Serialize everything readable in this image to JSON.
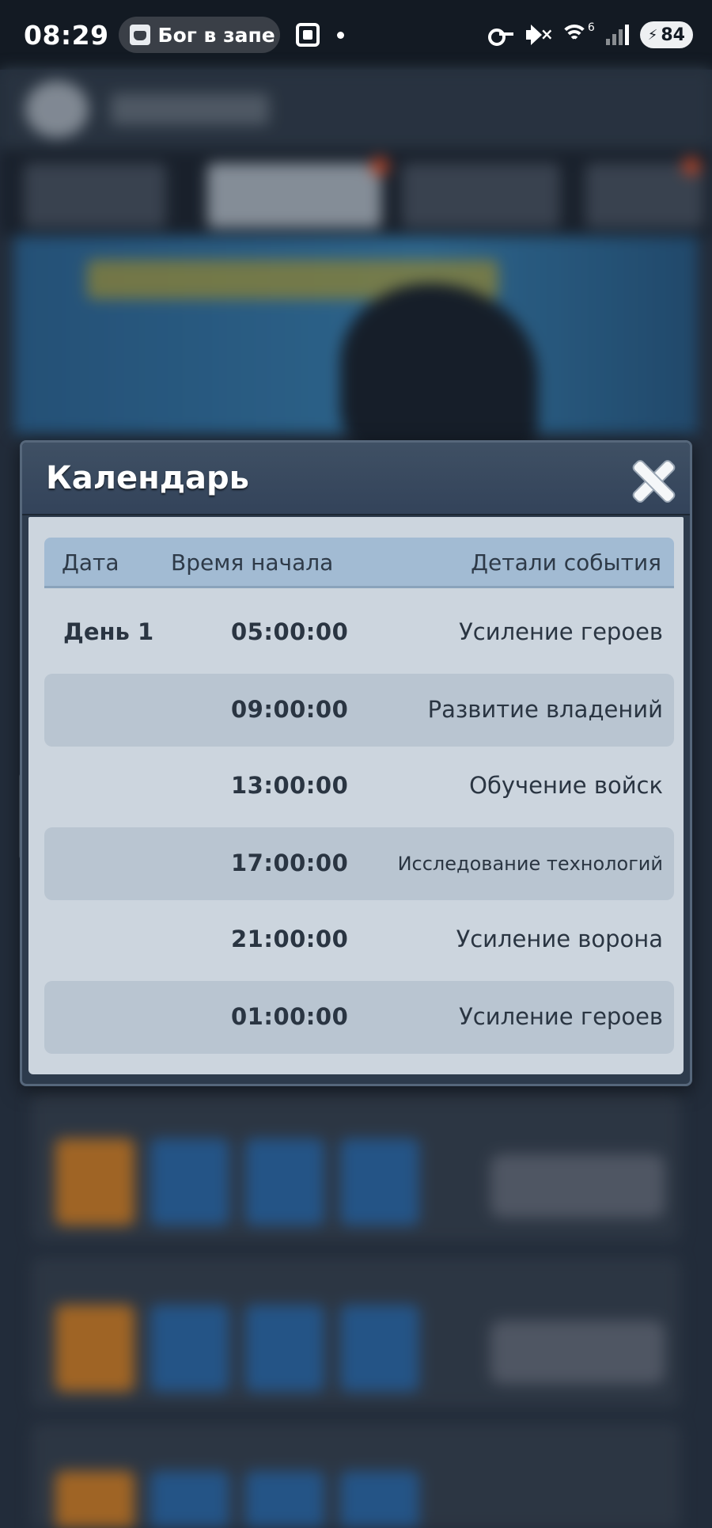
{
  "status_bar": {
    "time": "08:29",
    "notification_text": "Бог в запе",
    "wifi_badge": "6",
    "battery_level": "84"
  },
  "dialog": {
    "title": "Календарь",
    "close_icon": "close-icon",
    "columns": {
      "date": "Дата",
      "start_time": "Время начала",
      "event_details": "Детали события"
    },
    "rows": [
      {
        "date": "День 1",
        "time": "05:00:00",
        "event": "Усиление героев"
      },
      {
        "date": "",
        "time": "09:00:00",
        "event": "Развитие владений"
      },
      {
        "date": "",
        "time": "13:00:00",
        "event": "Обучение войск"
      },
      {
        "date": "",
        "time": "17:00:00",
        "event": "Исследование технологий"
      },
      {
        "date": "",
        "time": "21:00:00",
        "event": "Усиление ворона"
      },
      {
        "date": "",
        "time": "01:00:00",
        "event": "Усиление героев"
      }
    ]
  },
  "colors": {
    "dialog_frame": "#2d3b4c",
    "table_body": "#ccd5de",
    "table_header": "#a2bbd3",
    "alt_row": "#b9c5d1"
  }
}
